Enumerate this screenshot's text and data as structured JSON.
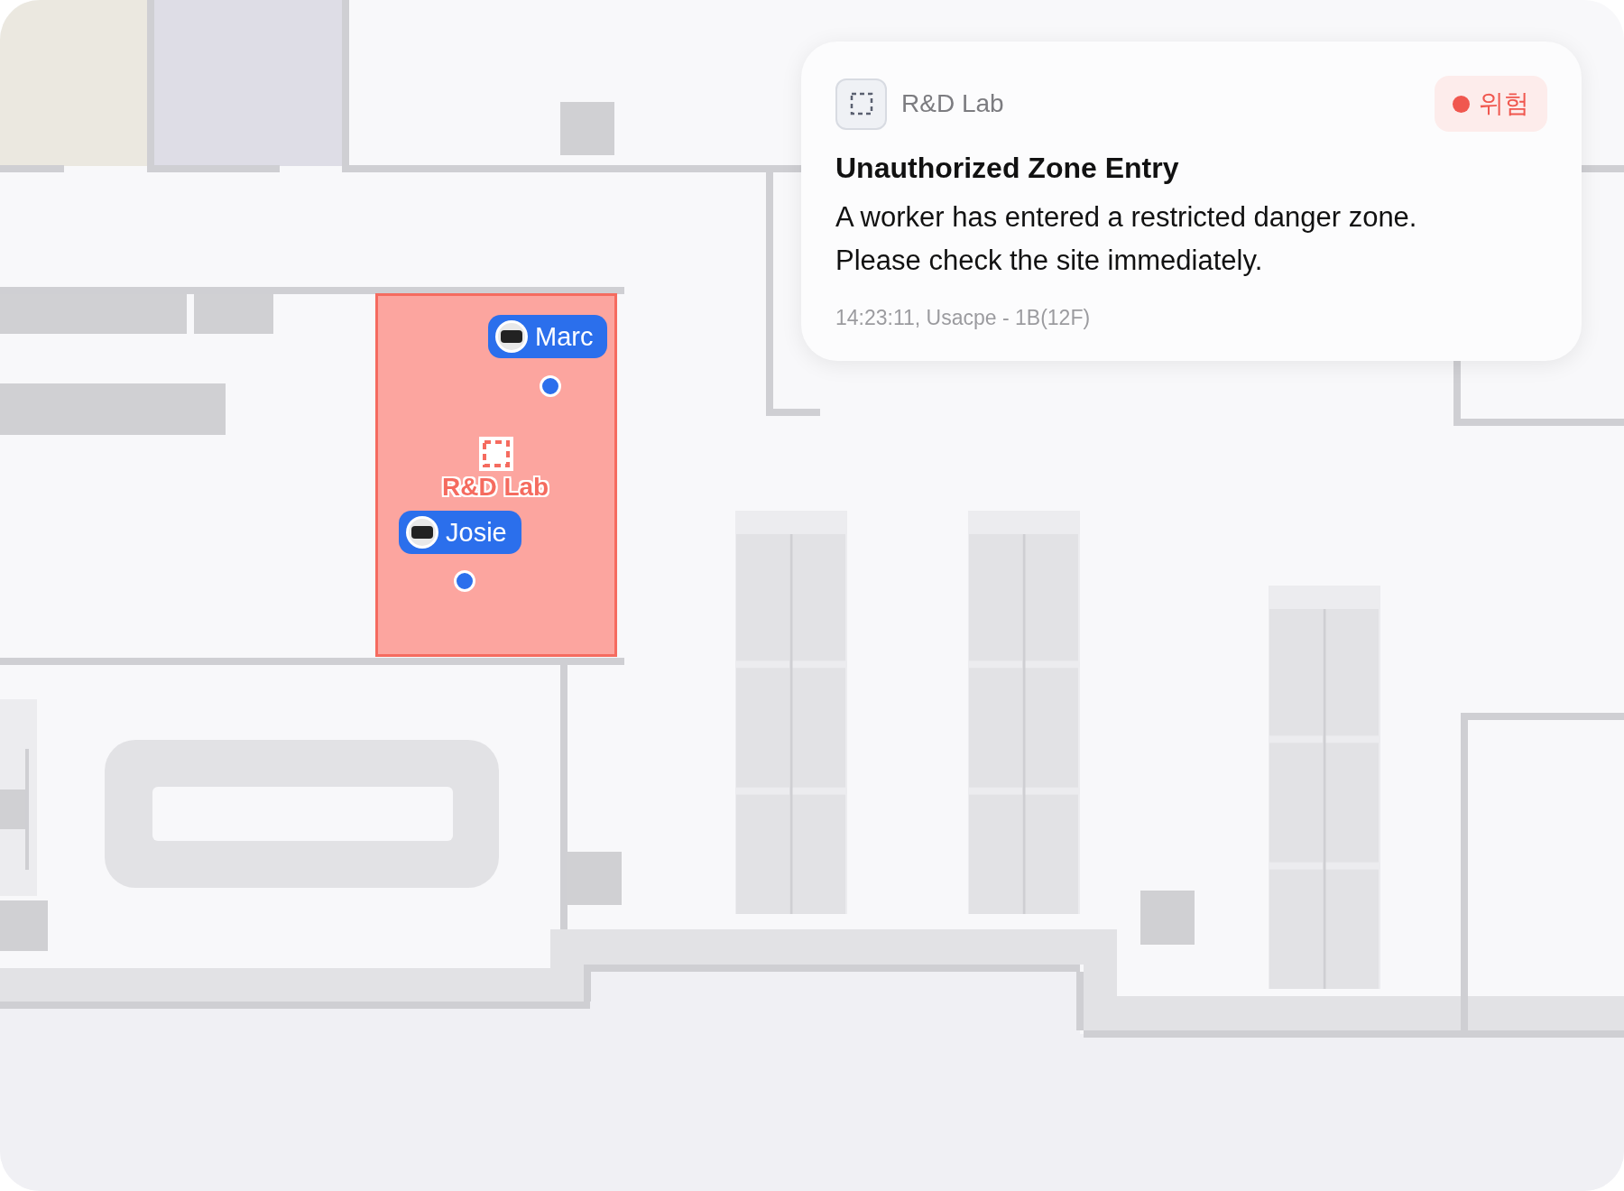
{
  "zone": {
    "name": "R&D Lab",
    "alert": true
  },
  "workers": [
    {
      "name": "Marc"
    },
    {
      "name": "Josie"
    }
  ],
  "alert_card": {
    "zone": "R&D Lab",
    "badge": "위험",
    "title": "Unauthorized Zone Entry",
    "message_lines": [
      "A worker has entered a restricted danger zone.",
      "Please check the site immediately."
    ],
    "meta": "14:23:11, Usacpe - 1B(12F)"
  }
}
